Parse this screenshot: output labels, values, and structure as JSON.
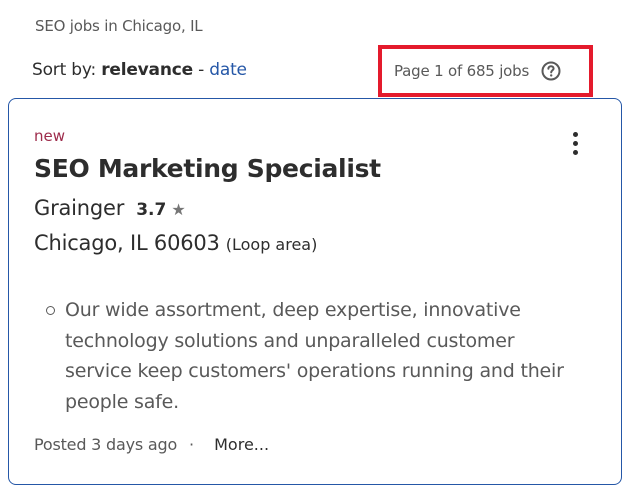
{
  "search": {
    "summary": "SEO jobs in Chicago, IL"
  },
  "sort": {
    "prefix": "Sort by: ",
    "active": "relevance",
    "separator": " - ",
    "alternate": "date"
  },
  "pagination": {
    "text": "Page 1 of 685 jobs",
    "help_icon": "question-circle-icon"
  },
  "job": {
    "badge": "new",
    "title": "SEO Marketing Specialist",
    "company": "Grainger",
    "rating": "3.7",
    "rating_icon": "star",
    "location": "Chicago, IL 60603",
    "area": "(Loop area)",
    "snippet": "Our wide assortment, deep expertise, innovative technology solutions and unparalleled customer service keep customers' operations running and their people safe.",
    "posted": "Posted 3 days ago",
    "separator": "·",
    "more": "More...",
    "menu_icon": "kebab-menu-icon"
  },
  "colors": {
    "link": "#2557a7",
    "new_badge": "#9d2b4b",
    "highlight_box": "#e41a2c",
    "card_border": "#2557a7"
  }
}
